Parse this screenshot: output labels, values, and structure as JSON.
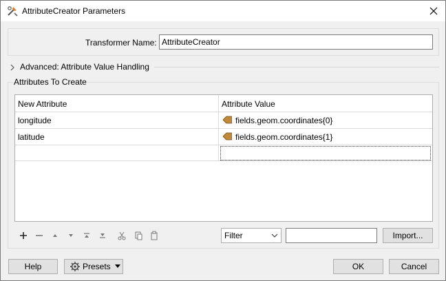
{
  "window": {
    "title": "AttributeCreator Parameters",
    "icon": "fme-transformer-icon",
    "close_icon": "close-icon"
  },
  "transformer": {
    "label": "Transformer Name:",
    "value": "AttributeCreator"
  },
  "advanced": {
    "label": "Advanced: Attribute Value Handling",
    "expanded": false
  },
  "attributes": {
    "group_label": "Attributes To Create",
    "columns": [
      "New Attribute",
      "Attribute Value"
    ],
    "rows": [
      {
        "name": "longitude",
        "value": "fields.geom.coordinates{0}",
        "value_icon": "attribute-value-icon"
      },
      {
        "name": "latitude",
        "value": "fields.geom.coordinates{1}",
        "value_icon": "attribute-value-icon"
      },
      {
        "name": "",
        "value": ""
      }
    ],
    "accent_color": "#c08a3e"
  },
  "toolbar": {
    "icons": [
      "add-icon",
      "remove-icon",
      "move-up-icon",
      "move-down-icon",
      "move-top-icon",
      "move-bottom-icon",
      "cut-icon",
      "copy-icon",
      "paste-icon"
    ],
    "filter_selected": "Filter",
    "filter_value": "",
    "import_label": "Import..."
  },
  "footer": {
    "help_label": "Help",
    "presets_label": "Presets",
    "ok_label": "OK",
    "cancel_label": "Cancel"
  }
}
